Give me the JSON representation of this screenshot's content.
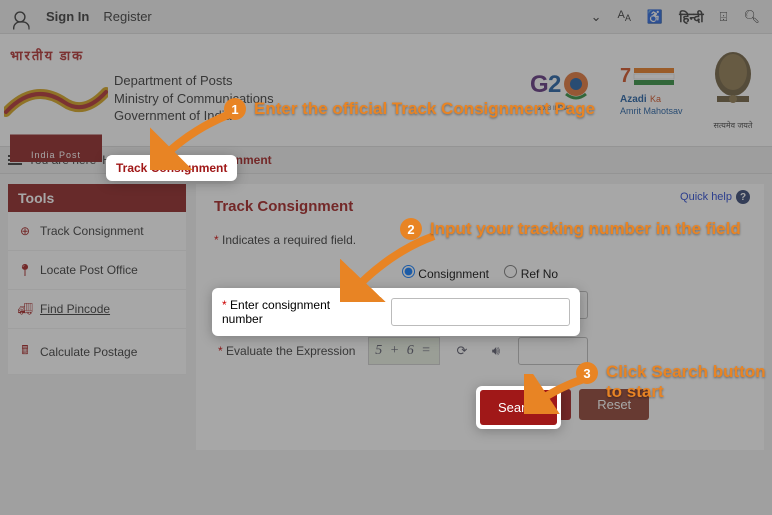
{
  "topbar": {
    "signin": "Sign In",
    "register": "Register",
    "hindi": "हिन्दी"
  },
  "header": {
    "logo_hindi": "भारतीय डाक",
    "logo_caption": "India Post",
    "dept1": "Department of Posts",
    "dept2": "Ministry of Communications",
    "dept3": "Government of India",
    "azadi1": "Azadi Ka",
    "azadi2": "Amrit Mahotsav",
    "emblem_txt": "सत्यमेव जयते"
  },
  "breadcrumb": {
    "prefix": "You are here",
    "home": "Home",
    "sep": ">>",
    "current": "Track Consignment"
  },
  "sidebar": {
    "title": "Tools",
    "items": [
      {
        "label": "Track Consignment"
      },
      {
        "label": "Locate Post Office"
      },
      {
        "label": "Find Pincode"
      },
      {
        "label": "Calculate Postage"
      }
    ]
  },
  "main": {
    "title": "Track Consignment",
    "quick": "Quick help",
    "required": "Indicates a required field.",
    "radio1": "Consignment",
    "radio2": "Ref No",
    "field_label": "Enter consignment number",
    "eval_label": "Evaluate the Expression",
    "captcha": "5 + 6 =",
    "search": "Search",
    "reset": "Reset"
  },
  "callouts": {
    "c1": "Enter the official Track Consignment Page",
    "c2": "Input your tracking number in the field",
    "c3": "Click Search button to start",
    "n1": "1",
    "n2": "2",
    "n3": "3"
  }
}
